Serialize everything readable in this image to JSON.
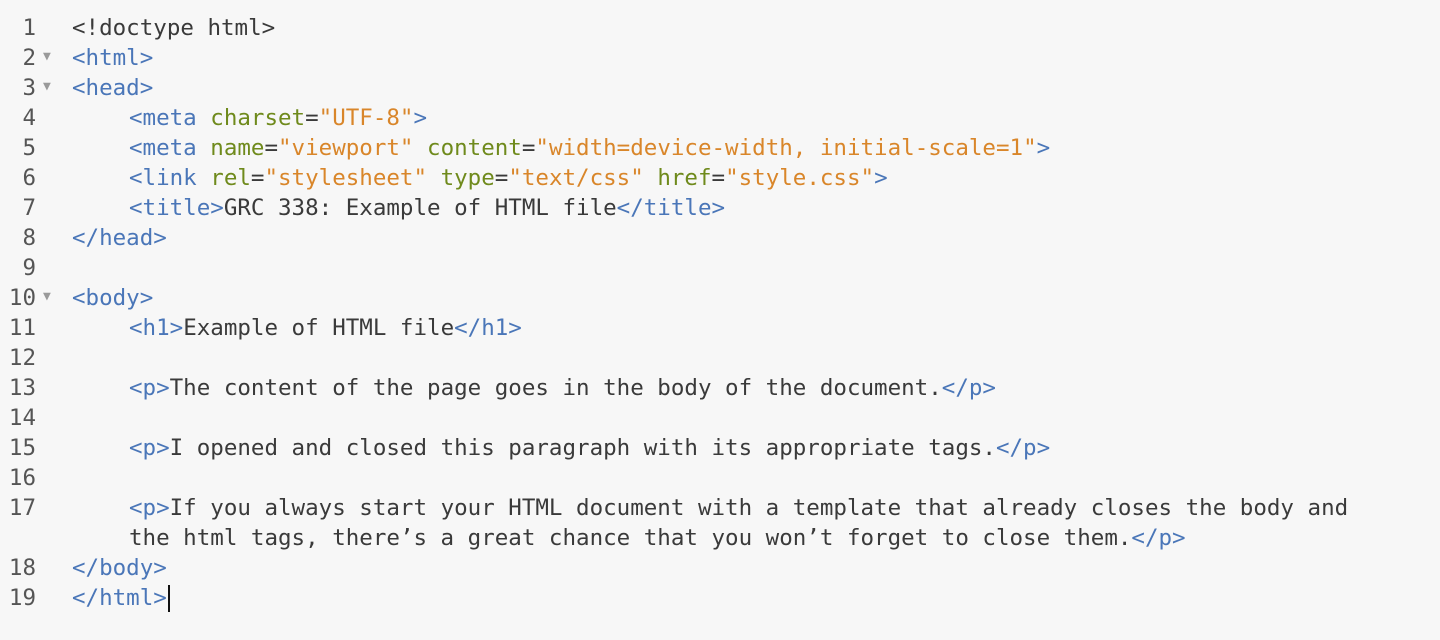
{
  "lines": [
    {
      "n": "1",
      "fold": false,
      "parts": [
        {
          "c": "plain",
          "t": "<!doctype html>"
        }
      ]
    },
    {
      "n": "2",
      "fold": true,
      "parts": [
        {
          "c": "tag",
          "t": "<html>"
        }
      ]
    },
    {
      "n": "3",
      "fold": true,
      "parts": [
        {
          "c": "tag",
          "t": "<head>"
        }
      ]
    },
    {
      "n": "4",
      "fold": false,
      "indent": true,
      "parts": [
        {
          "c": "tag",
          "t": "<meta "
        },
        {
          "c": "attr",
          "t": "charset"
        },
        {
          "c": "plain",
          "t": "="
        },
        {
          "c": "val",
          "t": "\"UTF-8\""
        },
        {
          "c": "tag",
          "t": ">"
        }
      ]
    },
    {
      "n": "5",
      "fold": false,
      "indent": true,
      "parts": [
        {
          "c": "tag",
          "t": "<meta "
        },
        {
          "c": "attr",
          "t": "name"
        },
        {
          "c": "plain",
          "t": "="
        },
        {
          "c": "val",
          "t": "\"viewport\""
        },
        {
          "c": "plain",
          "t": " "
        },
        {
          "c": "attr",
          "t": "content"
        },
        {
          "c": "plain",
          "t": "="
        },
        {
          "c": "val",
          "t": "\"width=device-width, initial-scale=1\""
        },
        {
          "c": "tag",
          "t": ">"
        }
      ]
    },
    {
      "n": "6",
      "fold": false,
      "indent": true,
      "parts": [
        {
          "c": "tag",
          "t": "<link "
        },
        {
          "c": "attr",
          "t": "rel"
        },
        {
          "c": "plain",
          "t": "="
        },
        {
          "c": "val",
          "t": "\"stylesheet\""
        },
        {
          "c": "plain",
          "t": " "
        },
        {
          "c": "attr",
          "t": "type"
        },
        {
          "c": "plain",
          "t": "="
        },
        {
          "c": "val",
          "t": "\"text/css\""
        },
        {
          "c": "plain",
          "t": " "
        },
        {
          "c": "attr",
          "t": "href"
        },
        {
          "c": "plain",
          "t": "="
        },
        {
          "c": "val",
          "t": "\"style.css\""
        },
        {
          "c": "tag",
          "t": ">"
        }
      ]
    },
    {
      "n": "7",
      "fold": false,
      "indent": true,
      "parts": [
        {
          "c": "tag",
          "t": "<title>"
        },
        {
          "c": "plain",
          "t": "GRC 338: Example of HTML file"
        },
        {
          "c": "tag",
          "t": "</title>"
        }
      ]
    },
    {
      "n": "8",
      "fold": false,
      "parts": [
        {
          "c": "tag",
          "t": "</head>"
        }
      ]
    },
    {
      "n": "9",
      "fold": false,
      "parts": []
    },
    {
      "n": "10",
      "fold": true,
      "parts": [
        {
          "c": "tag",
          "t": "<body>"
        }
      ]
    },
    {
      "n": "11",
      "fold": false,
      "indent": true,
      "parts": [
        {
          "c": "tag",
          "t": "<h1>"
        },
        {
          "c": "plain",
          "t": "Example of HTML file"
        },
        {
          "c": "tag",
          "t": "</h1>"
        }
      ]
    },
    {
      "n": "12",
      "fold": false,
      "parts": []
    },
    {
      "n": "13",
      "fold": false,
      "indent": true,
      "parts": [
        {
          "c": "tag",
          "t": "<p>"
        },
        {
          "c": "plain",
          "t": "The content of the page goes in the body of the document."
        },
        {
          "c": "tag",
          "t": "</p>"
        }
      ]
    },
    {
      "n": "14",
      "fold": false,
      "parts": []
    },
    {
      "n": "15",
      "fold": false,
      "indent": true,
      "parts": [
        {
          "c": "tag",
          "t": "<p>"
        },
        {
          "c": "plain",
          "t": "I opened and closed this paragraph with its appropriate tags."
        },
        {
          "c": "tag",
          "t": "</p>"
        }
      ]
    },
    {
      "n": "16",
      "fold": false,
      "parts": []
    },
    {
      "n": "17",
      "fold": false,
      "indent": true,
      "parts": [
        {
          "c": "tag",
          "t": "<p>"
        },
        {
          "c": "plain",
          "t": "If you always start your HTML document with a template that already closes the body and"
        }
      ]
    },
    {
      "n": "",
      "fold": false,
      "indent": true,
      "parts": [
        {
          "c": "plain",
          "t": "the html tags, there’s a great chance that you won’t forget to close them."
        },
        {
          "c": "tag",
          "t": "</p>"
        }
      ]
    },
    {
      "n": "18",
      "fold": false,
      "parts": [
        {
          "c": "tag",
          "t": "</body>"
        }
      ]
    },
    {
      "n": "19",
      "fold": false,
      "cursor": true,
      "parts": [
        {
          "c": "tag",
          "t": "</html>"
        }
      ]
    }
  ],
  "colors": {
    "background": "#f7f7f7",
    "tag": "#4a76b8",
    "attribute": "#6f8a1c",
    "string": "#d9862a",
    "text": "#3a3a3a"
  },
  "icons": {
    "fold": "fold-triangle-icon"
  }
}
